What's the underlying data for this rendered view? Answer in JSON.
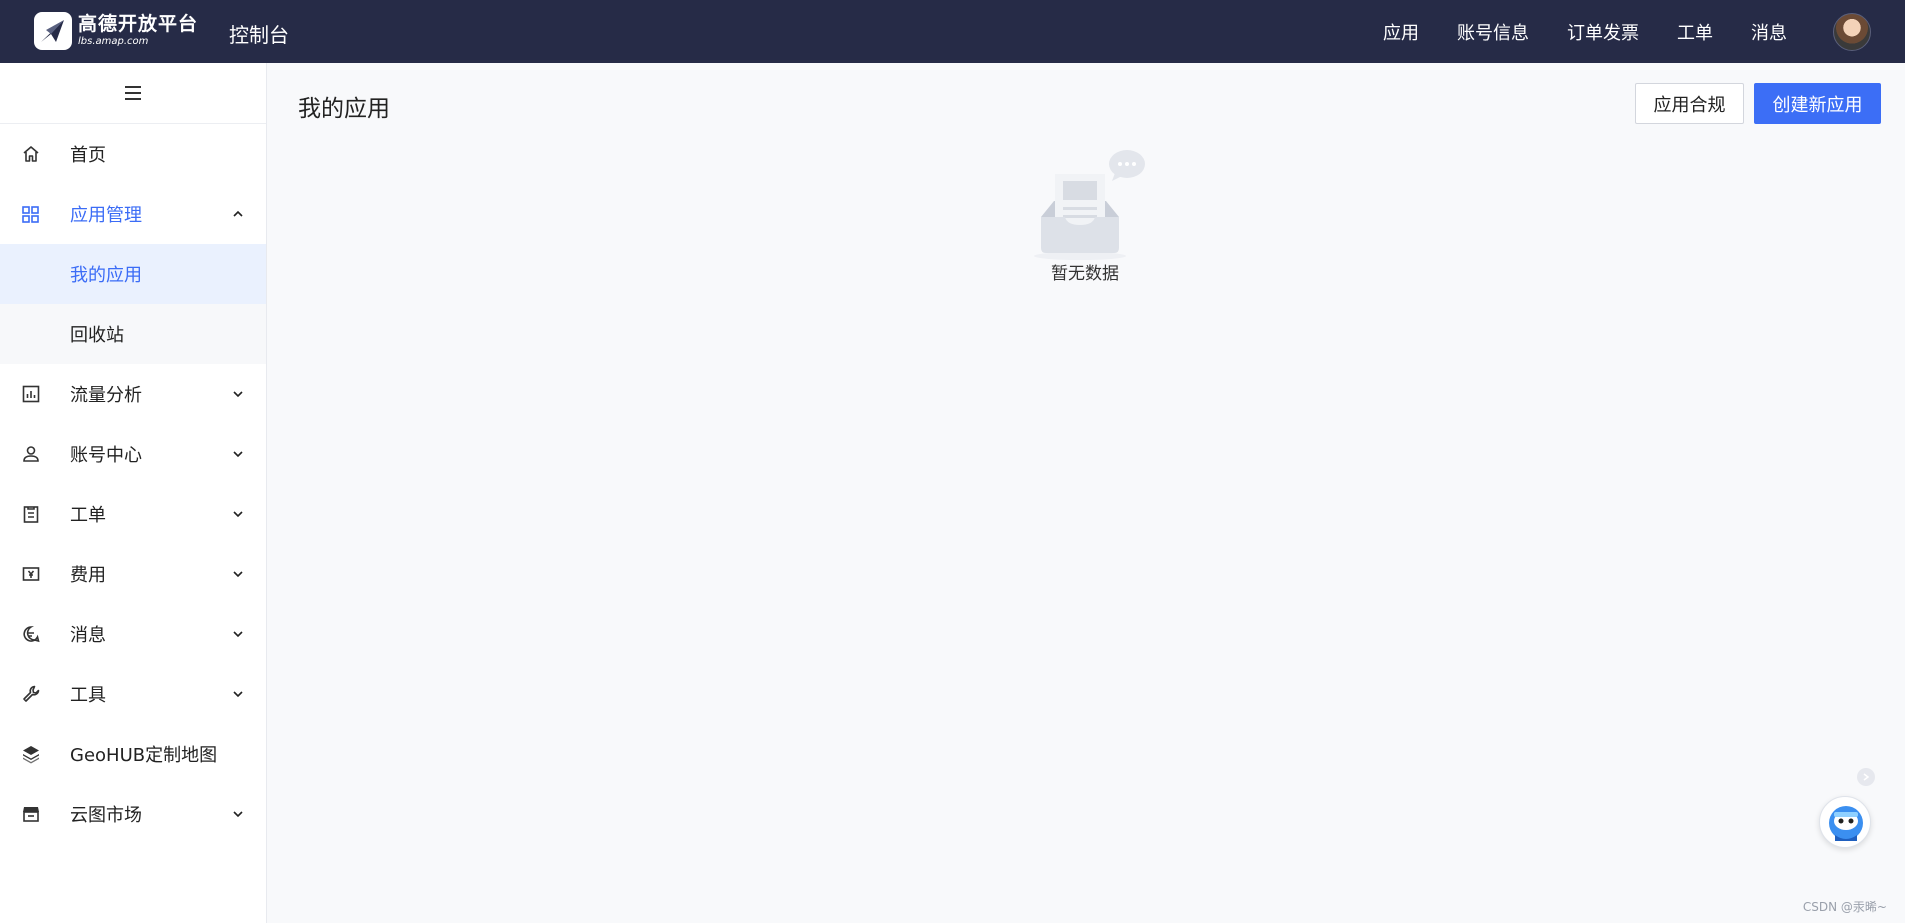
{
  "header": {
    "logo_name": "高德开放平台",
    "logo_sub": "lbs.amap.com",
    "console_title": "控制台",
    "nav": [
      "应用",
      "账号信息",
      "订单发票",
      "工单",
      "消息"
    ]
  },
  "sidebar": {
    "items": [
      {
        "label": "首页",
        "icon": "home-icon"
      },
      {
        "label": "应用管理",
        "icon": "grid-icon",
        "expanded": true,
        "children": [
          {
            "label": "我的应用",
            "selected": true
          },
          {
            "label": "回收站"
          }
        ]
      },
      {
        "label": "流量分析",
        "icon": "bar-chart-icon"
      },
      {
        "label": "账号中心",
        "icon": "user-icon"
      },
      {
        "label": "工单",
        "icon": "clipboard-icon"
      },
      {
        "label": "费用",
        "icon": "yuan-icon"
      },
      {
        "label": "消息",
        "icon": "message-icon"
      },
      {
        "label": "工具",
        "icon": "wrench-icon"
      },
      {
        "label": "GeoHUB定制地图",
        "icon": "layers-icon"
      },
      {
        "label": "云图市场",
        "icon": "store-icon"
      }
    ]
  },
  "main": {
    "title": "我的应用",
    "compliance_button": "应用合规",
    "create_button": "创建新应用",
    "empty_text": "暂无数据"
  },
  "watermark": "CSDN @汞晞~",
  "colors": {
    "topbar": "#262b47",
    "accent": "#3c6ef6",
    "selected_bg": "#eaf1fe"
  }
}
